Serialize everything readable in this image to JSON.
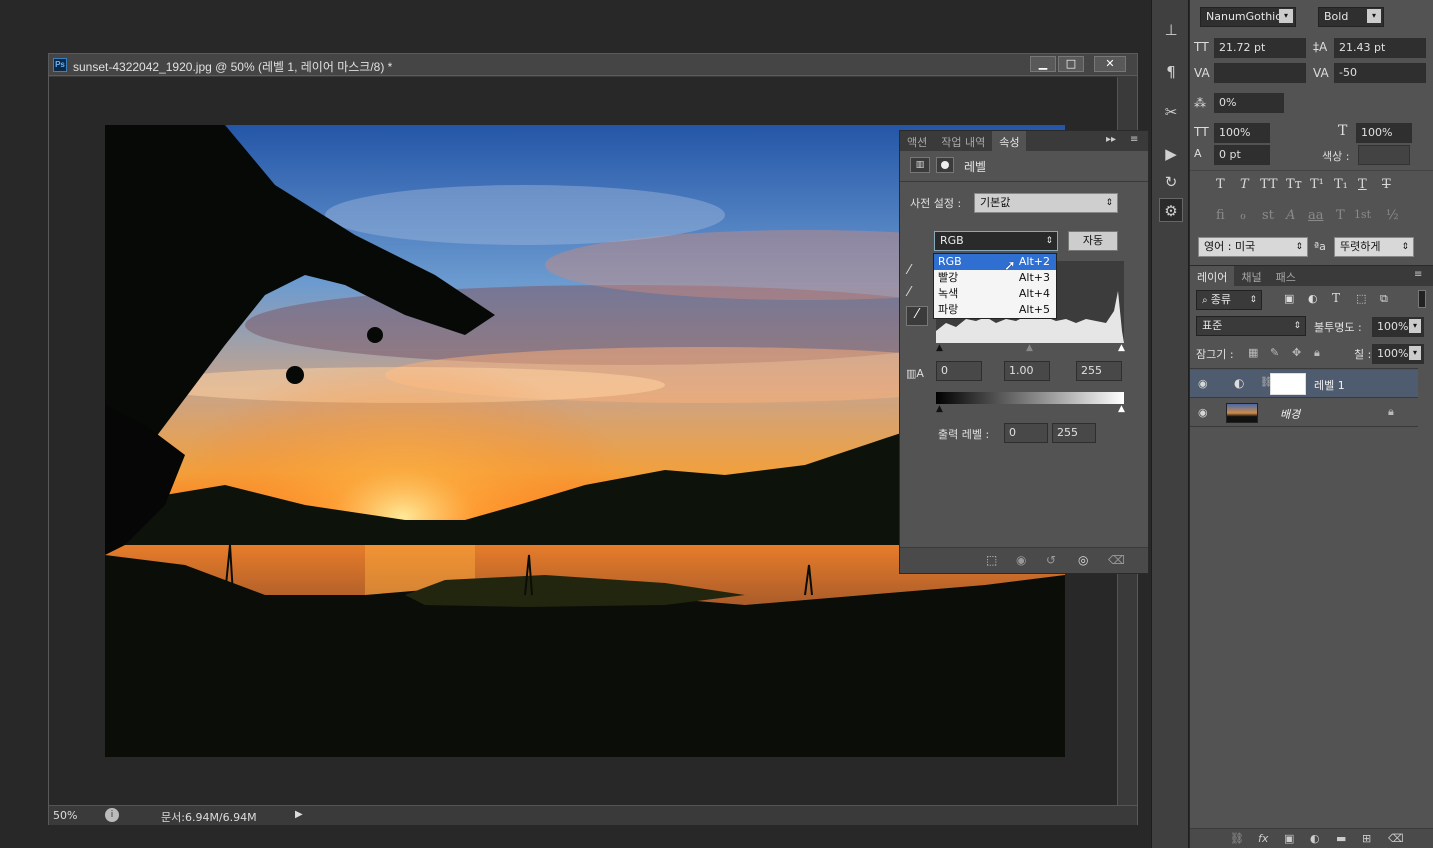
{
  "document": {
    "title": "sunset-4322042_1920.jpg @ 50% (레벨 1, 레이어 마스크/8) *",
    "app_badge": "Ps",
    "zoom": "50%",
    "doc_info": "문서:6.94M/6.94M",
    "window_buttons": [
      "▁",
      "□",
      "✕"
    ]
  },
  "properties_panel": {
    "tabs": [
      "액션",
      "작업 내역",
      "속성"
    ],
    "active_tab": "속성",
    "adjustment_name": "레벨",
    "preset_label": "사전 설정 :",
    "preset_value": "기본값",
    "channel_value": "RGB",
    "auto_button": "자동",
    "input_black": "0",
    "input_gamma": "1.00",
    "input_white": "255",
    "output_label": "출력 레벨 :",
    "output_black": "0",
    "output_white": "255",
    "channel_menu": [
      {
        "label": "RGB",
        "shortcut": "Alt+2",
        "selected": true
      },
      {
        "label": "빨강",
        "shortcut": "Alt+3",
        "selected": false
      },
      {
        "label": "녹색",
        "shortcut": "Alt+4",
        "selected": false
      },
      {
        "label": "파랑",
        "shortcut": "Alt+5",
        "selected": false
      }
    ]
  },
  "character_panel": {
    "font_family": "NanumGothic",
    "font_style": "Bold",
    "font_size": "21.72 pt",
    "leading": "21.43 pt",
    "kerning": "",
    "tracking": "-50",
    "tsume": "0%",
    "vertical_scale": "100%",
    "horizontal_scale": "100%",
    "baseline_shift": "0 pt",
    "color_label": "색상 :",
    "language": "영어 : 미국",
    "antialias": "뚜렷하게",
    "style_glyphs": [
      "T",
      "T",
      "TT",
      "Tт",
      "T¹",
      "T₁",
      "T",
      "T"
    ],
    "opentype_glyphs": [
      "fi",
      "ℴ",
      "st",
      "A",
      "aa",
      "T",
      "1st",
      "½"
    ]
  },
  "layers_panel": {
    "tabs": [
      "레이어",
      "채널",
      "패스"
    ],
    "active_tab": "레이어",
    "filter_kind": "종류",
    "blend_mode": "표준",
    "opacity_label": "불투명도 :",
    "opacity_value": "100%",
    "lock_label": "잠그기 :",
    "fill_label": "칠 :",
    "fill_value": "100%",
    "layers": [
      {
        "name": "레벨 1",
        "selected": true
      },
      {
        "name": "배경",
        "selected": false,
        "italic": true
      }
    ]
  },
  "colors": {
    "selection": "#2f6fd1",
    "panel": "#535353",
    "layer_selected": "#4f5b6e"
  }
}
